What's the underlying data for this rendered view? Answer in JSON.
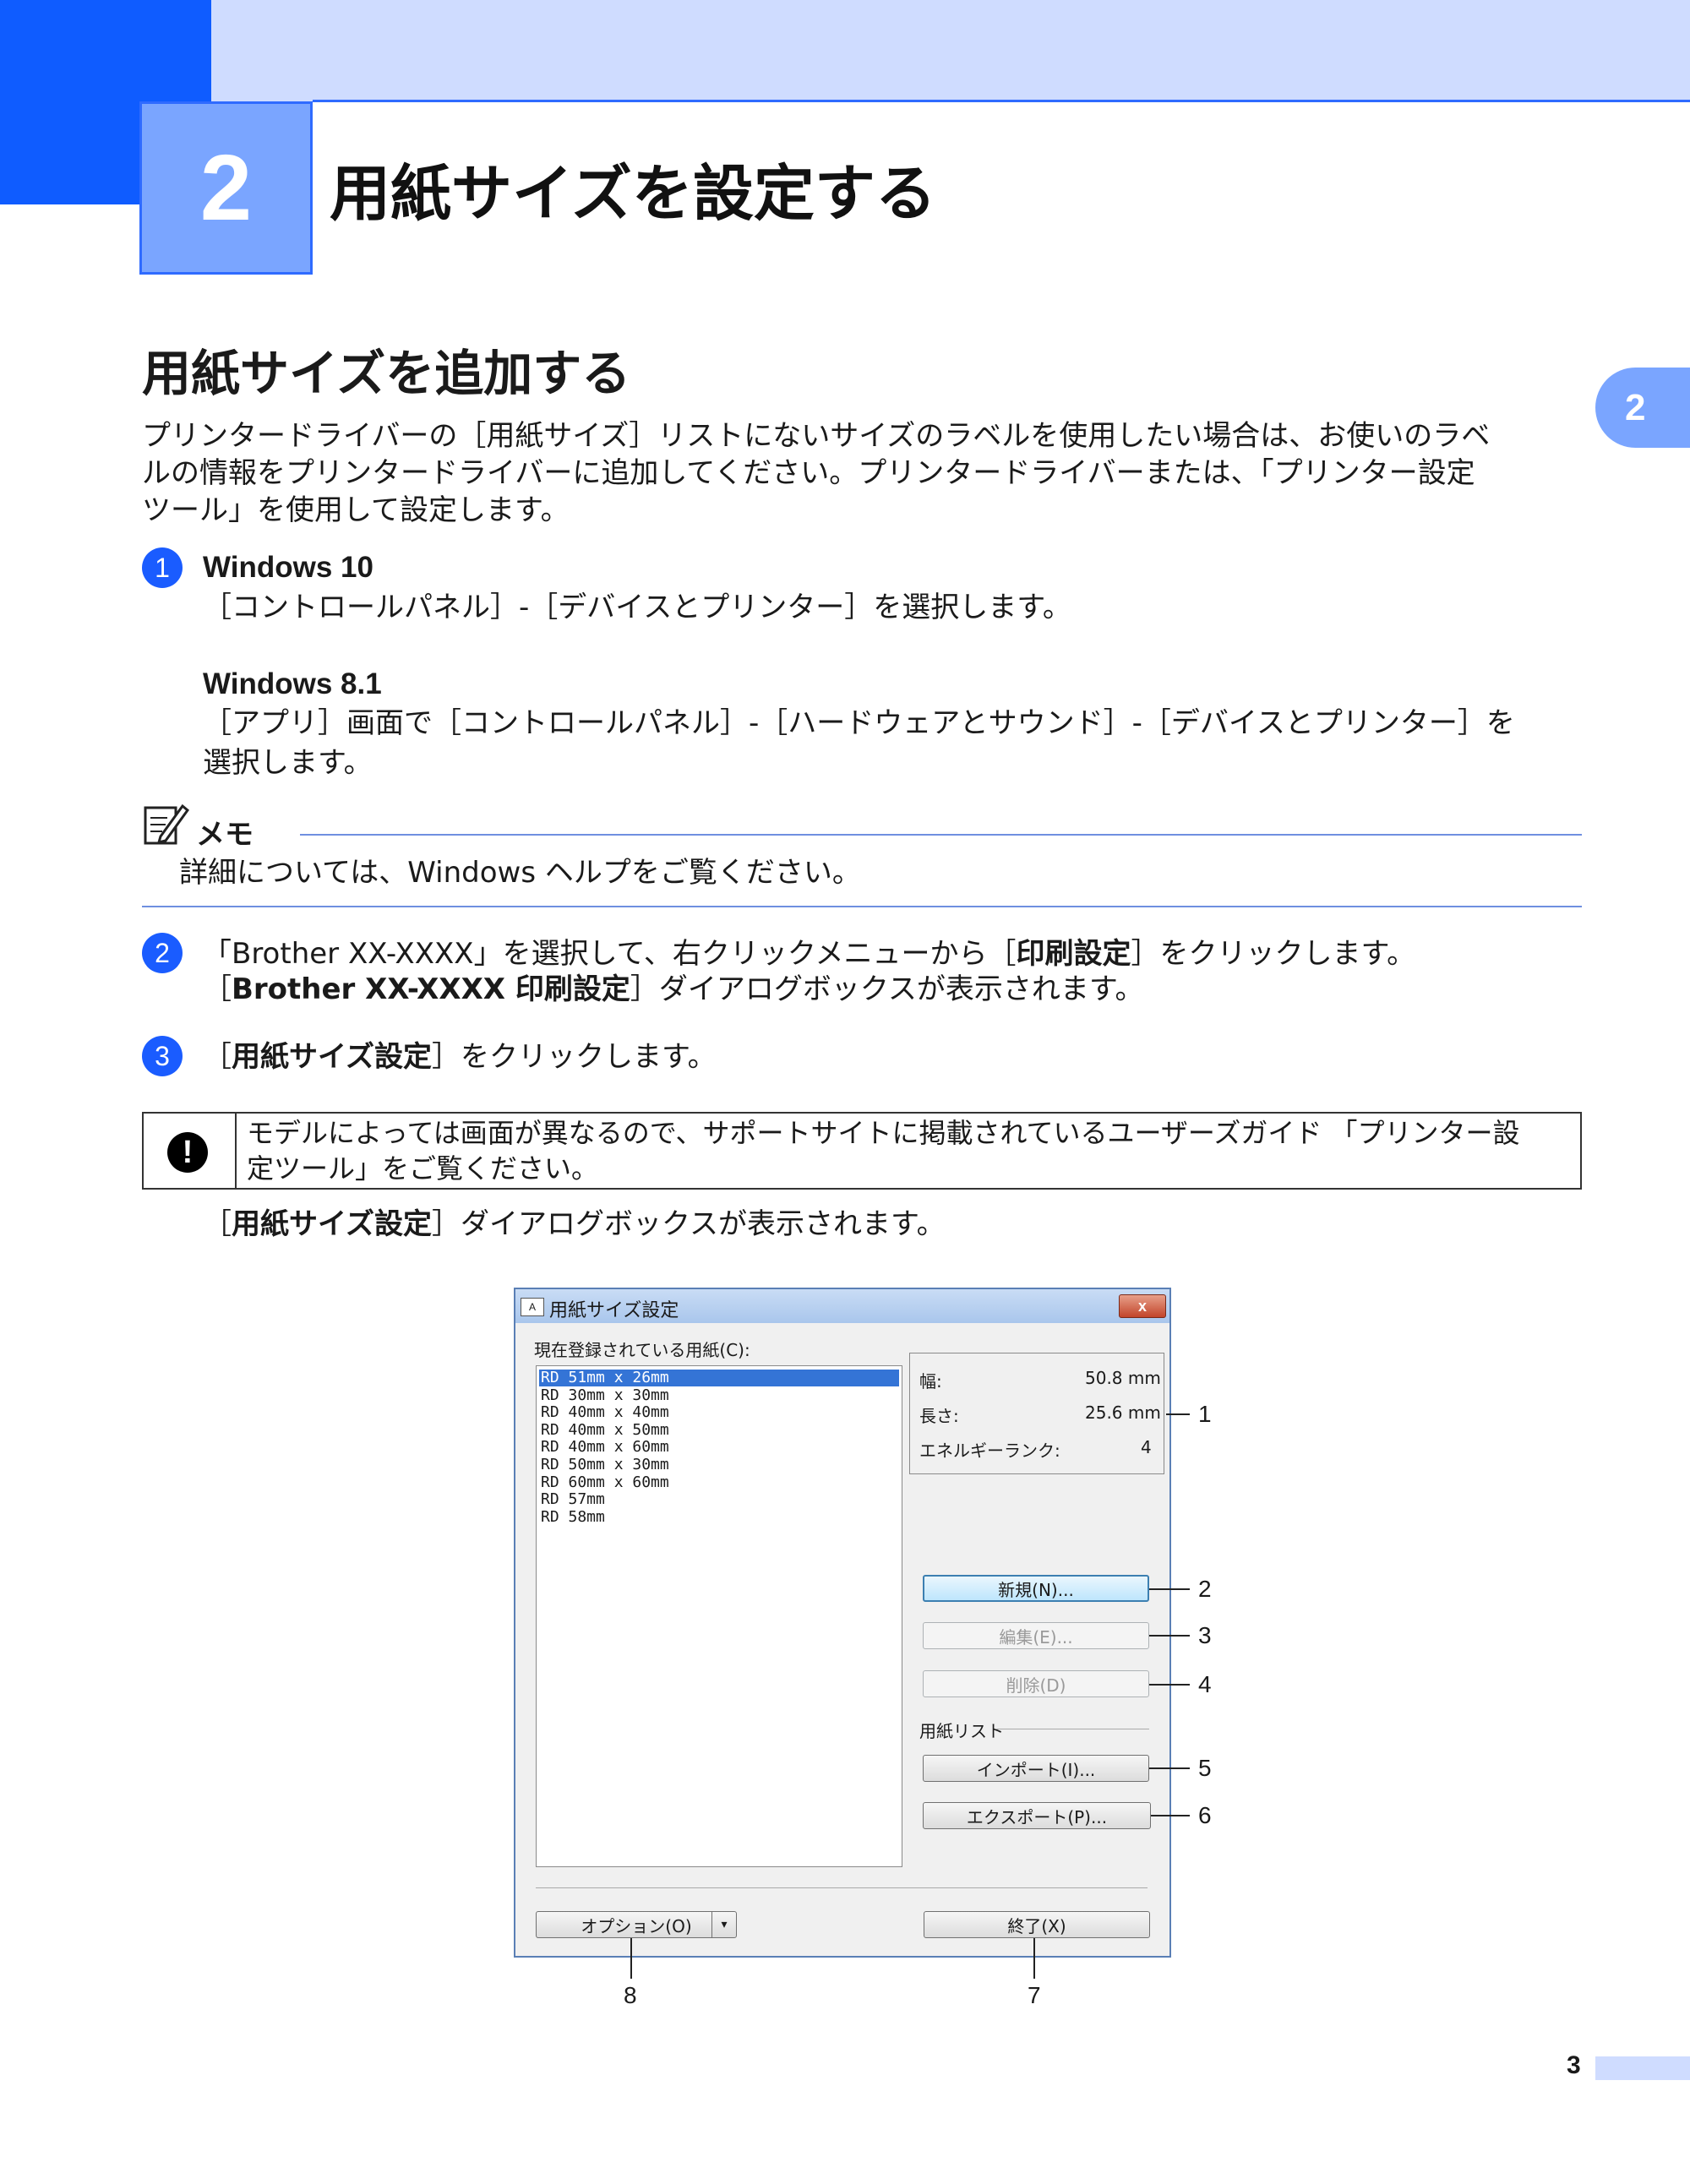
{
  "chapter": {
    "number": "2",
    "title": "用紙サイズを設定する",
    "side_tab": "2"
  },
  "section": {
    "title": "用紙サイズを追加する"
  },
  "intro": {
    "line1": "プリンタードライバーの［用紙サイズ］リストにないサイズのラベルを使用したい場合は、お使いのラベ",
    "line2": "ルの情報をプリンタードライバーに追加してください。プリンタードライバーまたは、「プリンター設定",
    "line3": "ツール」を使用して設定します。"
  },
  "steps": [
    {
      "num": "1",
      "win10_title": "Windows 10",
      "win10_text": "［コントロールパネル］-［デバイスとプリンター］を選択します。",
      "win81_title": "Windows 8.1",
      "win81_text1": "［アプリ］画面で［コントロールパネル］-［ハードウェアとサウンド］-［デバイスとプリンター］を",
      "win81_text2": "選択します。"
    },
    {
      "num": "2",
      "text_a": "「Brother XX-XXXX」を選択して、右クリックメニューから［",
      "text_a_bold": "印刷設定",
      "text_a_end": "］をクリックします。",
      "text_b_start": "［",
      "text_b_bold": "Brother XX-XXXX 印刷設定",
      "text_b_end": "］ダイアログボックスが表示されます。"
    },
    {
      "num": "3",
      "text_start": "［",
      "text_bold": "用紙サイズ設定",
      "text_end": "］をクリックします。"
    }
  ],
  "memo": {
    "label": "メモ",
    "text": "詳細については、Windows ヘルプをご覧ください。"
  },
  "note": {
    "icon": "exclamation-icon",
    "line1": "モデルによっては画面が異なるので、サポートサイトに掲載されているユーザーズガイド 「プリンター設",
    "line2": "定ツール」をご覧ください。"
  },
  "after_note": {
    "start": "［",
    "bold": "用紙サイズ設定",
    "end": "］ダイアログボックスが表示されます。"
  },
  "dialog": {
    "title": "用紙サイズ設定",
    "app_icon": "A",
    "close": "x",
    "list_label": "現在登録されている用紙(C):",
    "list_items": [
      "RD 51mm x 26mm",
      "RD 30mm x 30mm",
      "RD 40mm x 40mm",
      "RD 40mm x 50mm",
      "RD 40mm x 60mm",
      "RD 50mm x 30mm",
      "RD 60mm x 60mm",
      "RD 57mm",
      "RD 58mm"
    ],
    "selected_index": 0,
    "info": [
      {
        "label": "幅:",
        "value": "50.8 mm"
      },
      {
        "label": "長さ:",
        "value": "25.6 mm"
      },
      {
        "label": "エネルギーランク:",
        "value": "4"
      }
    ],
    "buttons": {
      "new": "新規(N)...",
      "edit": "編集(E)...",
      "delete": "削除(D)",
      "paper_list_group": "用紙リスト",
      "import": "インポート(I)...",
      "export": "エクスポート(P)...",
      "option": "オプション(O)",
      "option_arrow": "▾",
      "exit": "終了(X)"
    }
  },
  "callouts": [
    "1",
    "2",
    "3",
    "4",
    "5",
    "6",
    "7",
    "8"
  ],
  "page_number": "3"
}
